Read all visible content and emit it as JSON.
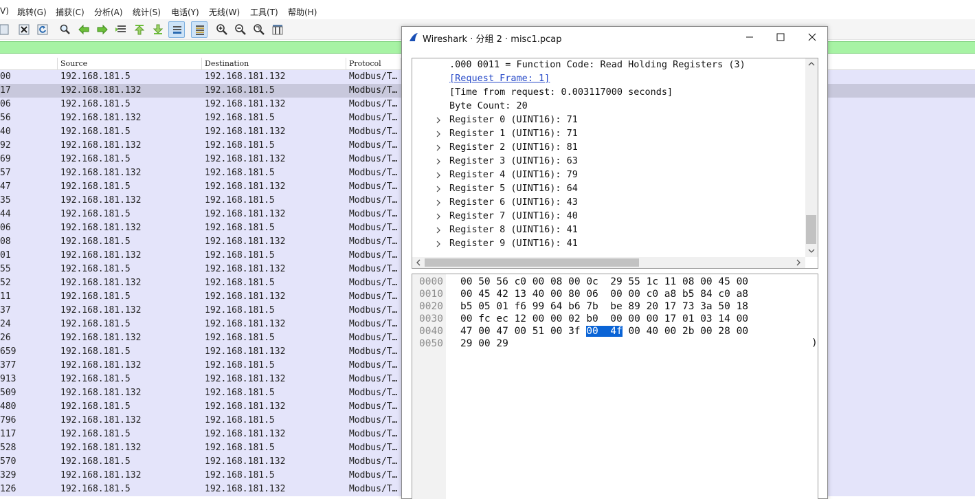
{
  "menu": [
    "V)",
    "跳转(G)",
    "捕获(C)",
    "分析(A)",
    "统计(S)",
    "电话(Y)",
    "无线(W)",
    "工具(T)",
    "帮助(H)"
  ],
  "packet_list": {
    "columns": [
      "Source",
      "Destination",
      "Protocol"
    ],
    "rows": [
      {
        "no": "00",
        "src": "192.168.181.5",
        "dst": "192.168.181.132",
        "proto": "Modbus/T…"
      },
      {
        "no": "17",
        "src": "192.168.181.132",
        "dst": "192.168.181.5",
        "proto": "Modbus/T…",
        "selected": true
      },
      {
        "no": "06",
        "src": "192.168.181.5",
        "dst": "192.168.181.132",
        "proto": "Modbus/T…"
      },
      {
        "no": "56",
        "src": "192.168.181.132",
        "dst": "192.168.181.5",
        "proto": "Modbus/T…"
      },
      {
        "no": "40",
        "src": "192.168.181.5",
        "dst": "192.168.181.132",
        "proto": "Modbus/T…"
      },
      {
        "no": "92",
        "src": "192.168.181.132",
        "dst": "192.168.181.5",
        "proto": "Modbus/T…"
      },
      {
        "no": "69",
        "src": "192.168.181.5",
        "dst": "192.168.181.132",
        "proto": "Modbus/T…"
      },
      {
        "no": "57",
        "src": "192.168.181.132",
        "dst": "192.168.181.5",
        "proto": "Modbus/T…"
      },
      {
        "no": "47",
        "src": "192.168.181.5",
        "dst": "192.168.181.132",
        "proto": "Modbus/T…"
      },
      {
        "no": "35",
        "src": "192.168.181.132",
        "dst": "192.168.181.5",
        "proto": "Modbus/T…"
      },
      {
        "no": "44",
        "src": "192.168.181.5",
        "dst": "192.168.181.132",
        "proto": "Modbus/T…"
      },
      {
        "no": "06",
        "src": "192.168.181.132",
        "dst": "192.168.181.5",
        "proto": "Modbus/T…"
      },
      {
        "no": "08",
        "src": "192.168.181.5",
        "dst": "192.168.181.132",
        "proto": "Modbus/T…"
      },
      {
        "no": "01",
        "src": "192.168.181.132",
        "dst": "192.168.181.5",
        "proto": "Modbus/T…"
      },
      {
        "no": "55",
        "src": "192.168.181.5",
        "dst": "192.168.181.132",
        "proto": "Modbus/T…"
      },
      {
        "no": "52",
        "src": "192.168.181.132",
        "dst": "192.168.181.5",
        "proto": "Modbus/T…"
      },
      {
        "no": "11",
        "src": "192.168.181.5",
        "dst": "192.168.181.132",
        "proto": "Modbus/T…"
      },
      {
        "no": "37",
        "src": "192.168.181.132",
        "dst": "192.168.181.5",
        "proto": "Modbus/T…"
      },
      {
        "no": "24",
        "src": "192.168.181.5",
        "dst": "192.168.181.132",
        "proto": "Modbus/T…"
      },
      {
        "no": "26",
        "src": "192.168.181.132",
        "dst": "192.168.181.5",
        "proto": "Modbus/T…"
      },
      {
        "no": "659",
        "src": "192.168.181.5",
        "dst": "192.168.181.132",
        "proto": "Modbus/T…"
      },
      {
        "no": "377",
        "src": "192.168.181.132",
        "dst": "192.168.181.5",
        "proto": "Modbus/T…"
      },
      {
        "no": "913",
        "src": "192.168.181.5",
        "dst": "192.168.181.132",
        "proto": "Modbus/T…"
      },
      {
        "no": "509",
        "src": "192.168.181.132",
        "dst": "192.168.181.5",
        "proto": "Modbus/T…"
      },
      {
        "no": "480",
        "src": "192.168.181.5",
        "dst": "192.168.181.132",
        "proto": "Modbus/T…"
      },
      {
        "no": "796",
        "src": "192.168.181.132",
        "dst": "192.168.181.5",
        "proto": "Modbus/T…"
      },
      {
        "no": "117",
        "src": "192.168.181.5",
        "dst": "192.168.181.132",
        "proto": "Modbus/T…"
      },
      {
        "no": "528",
        "src": "192.168.181.132",
        "dst": "192.168.181.5",
        "proto": "Modbus/T…"
      },
      {
        "no": "570",
        "src": "192.168.181.5",
        "dst": "192.168.181.132",
        "proto": "Modbus/T…"
      },
      {
        "no": "329",
        "src": "192.168.181.132",
        "dst": "192.168.181.5",
        "proto": "Modbus/T…"
      },
      {
        "no": "126",
        "src": "192.168.181.5",
        "dst": "192.168.181.132",
        "proto": "Modbus/T…"
      }
    ]
  },
  "dialog": {
    "title": "Wireshark · 分组 2 · misc1.pcap",
    "tree": [
      {
        "text": ".000 0011 = Function Code: Read Holding Registers (3)",
        "expandable": false,
        "link": false
      },
      {
        "text": "[Request Frame: 1]",
        "expandable": false,
        "link": true
      },
      {
        "text": "[Time from request: 0.003117000 seconds]",
        "expandable": false,
        "link": false
      },
      {
        "text": "Byte Count: 20",
        "expandable": false,
        "link": false
      },
      {
        "text": "Register 0 (UINT16): 71",
        "expandable": true,
        "link": false
      },
      {
        "text": "Register 1 (UINT16): 71",
        "expandable": true,
        "link": false
      },
      {
        "text": "Register 2 (UINT16): 81",
        "expandable": true,
        "link": false
      },
      {
        "text": "Register 3 (UINT16): 63",
        "expandable": true,
        "link": false
      },
      {
        "text": "Register 4 (UINT16): 79",
        "expandable": true,
        "link": false
      },
      {
        "text": "Register 5 (UINT16): 64",
        "expandable": true,
        "link": false
      },
      {
        "text": "Register 6 (UINT16): 43",
        "expandable": true,
        "link": false
      },
      {
        "text": "Register 7 (UINT16): 40",
        "expandable": true,
        "link": false
      },
      {
        "text": "Register 8 (UINT16): 41",
        "expandable": true,
        "link": false
      },
      {
        "text": "Register 9 (UINT16): 41",
        "expandable": true,
        "link": false
      }
    ],
    "hex": [
      {
        "offset": "0000",
        "bytes": "00 50 56 c0 00 08 00 0c  29 55 1c 11 08 00 45 00"
      },
      {
        "offset": "0010",
        "bytes": "00 45 42 13 40 00 80 06  00 00 c0 a8 b5 84 c0 a8"
      },
      {
        "offset": "0020",
        "bytes": "b5 05 01 f6 99 64 b6 7b  be 89 20 17 73 3a 50 18"
      },
      {
        "offset": "0030",
        "bytes": "00 fc ec 12 00 00 02 b0  00 00 00 17 01 03 14 00"
      },
      {
        "offset": "0040",
        "bytes_before": "47 00 47 00 51 00 3f ",
        "bytes_selected": "00  4f",
        "bytes_after": " 00 40 00 2b 00 28 00"
      },
      {
        "offset": "0050",
        "bytes": "29 00 29"
      }
    ],
    "hex_ascii_fragment": ")"
  },
  "colors": {
    "accent_blue": "#0a64d6",
    "filter_green": "#a7f3a4",
    "row_bg": "#e4e4fa",
    "row_selected": "#c8c8dc"
  }
}
